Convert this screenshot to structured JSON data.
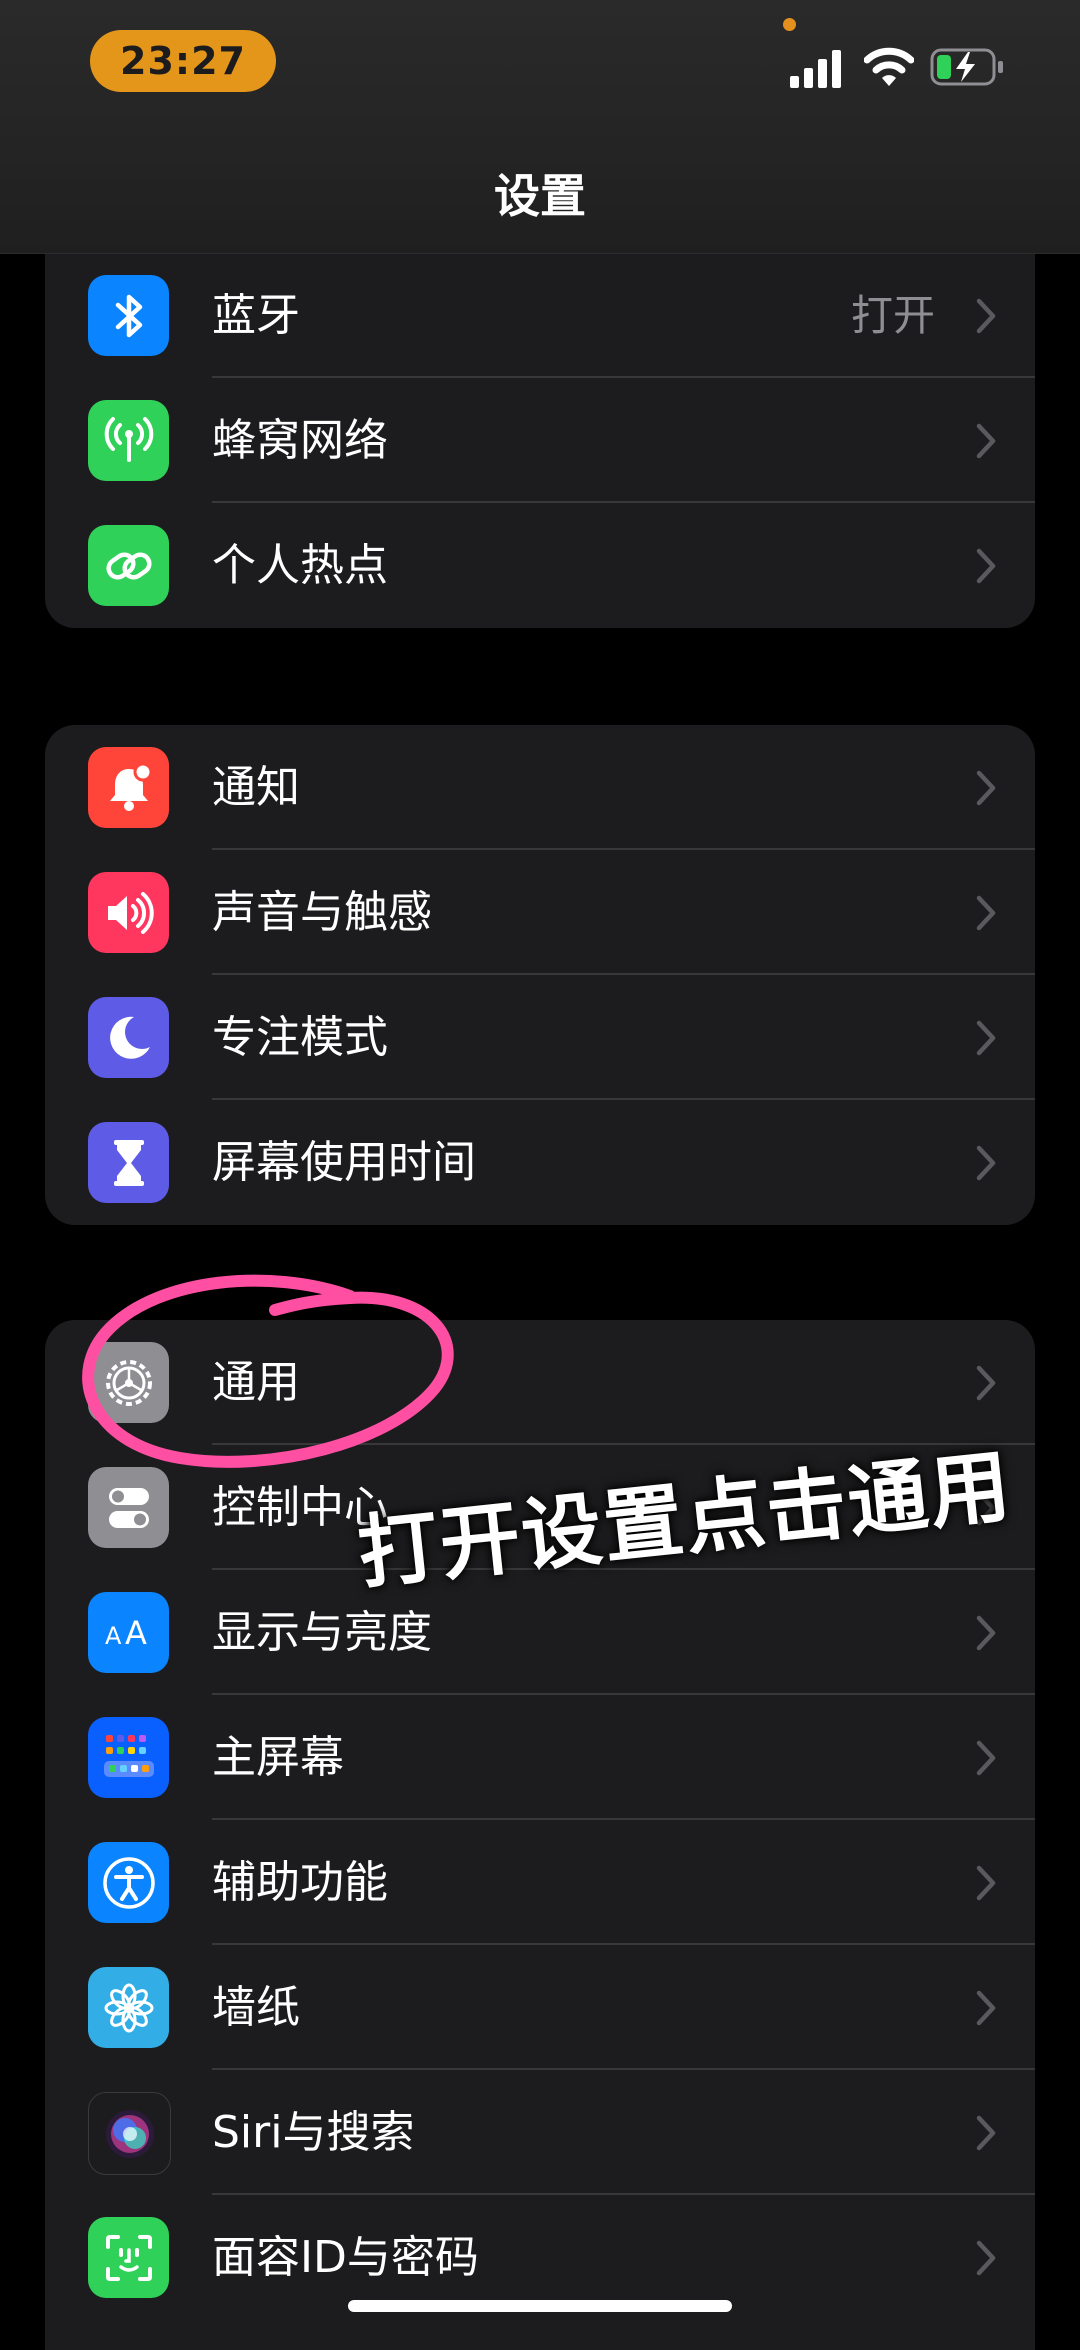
{
  "status_bar": {
    "time": "23:27",
    "accent": "#e3961a"
  },
  "nav": {
    "title": "设置"
  },
  "groups": [
    {
      "rows": [
        {
          "label": "蓝牙",
          "value": "打开",
          "icon": "bluetooth-icon",
          "color": "#0a84ff"
        },
        {
          "label": "蜂窝网络",
          "icon": "antenna-icon",
          "color": "#30d158"
        },
        {
          "label": "个人热点",
          "icon": "link-icon",
          "color": "#30d158"
        }
      ]
    },
    {
      "rows": [
        {
          "label": "通知",
          "icon": "bell-icon",
          "color": "#ff453a"
        },
        {
          "label": "声音与触感",
          "icon": "speaker-icon",
          "color": "#ff375f"
        },
        {
          "label": "专注模式",
          "icon": "moon-icon",
          "color": "#5e5ce6"
        },
        {
          "label": "屏幕使用时间",
          "icon": "hourglass-icon",
          "color": "#5e5ce6"
        }
      ]
    },
    {
      "rows": [
        {
          "label": "通用",
          "icon": "gear-icon",
          "color": "#8e8e93"
        },
        {
          "label": "控制中心",
          "icon": "toggles-icon",
          "color": "#8e8e93"
        },
        {
          "label": "显示与亮度",
          "icon": "text-size-icon",
          "color": "#0a84ff"
        },
        {
          "label": "主屏幕",
          "icon": "home-grid-icon",
          "color": "#0a60ff"
        },
        {
          "label": "辅助功能",
          "icon": "accessibility-icon",
          "color": "#0a84ff"
        },
        {
          "label": "墙纸",
          "icon": "flower-icon",
          "color": "#32ade6"
        },
        {
          "label": "Siri与搜索",
          "icon": "siri-icon",
          "color": "#1c1c1e"
        },
        {
          "label": "面容ID与密码",
          "icon": "face-id-icon",
          "color": "#30d158"
        }
      ]
    }
  ],
  "annotation": {
    "text": "打开设置点击通用",
    "circle_color": "#ff4fa3"
  }
}
